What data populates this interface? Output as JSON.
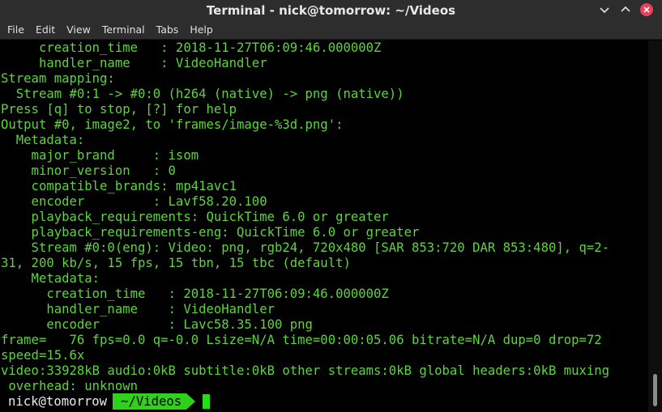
{
  "window": {
    "title": "Terminal - nick@tomorrow: ~/Videos"
  },
  "menu": [
    "File",
    "Edit",
    "View",
    "Terminal",
    "Tabs",
    "Help"
  ],
  "colors": {
    "terminal_text": "#5cd43c",
    "background": "#000000",
    "titlebar": "#2d2d2d",
    "prompt_dir_bg": "#2fd11c",
    "close_button": "#e93f57"
  },
  "terminal": {
    "lines": [
      "     creation_time   : 2018-11-27T06:09:46.000000Z",
      "     handler_name    : VideoHandler",
      "Stream mapping:",
      "  Stream #0:1 -> #0:0 (h264 (native) -> png (native))",
      "Press [q] to stop, [?] for help",
      "Output #0, image2, to 'frames/image-%3d.png':",
      "  Metadata:",
      "    major_brand     : isom",
      "    minor_version   : 0",
      "    compatible_brands: mp41avc1",
      "    encoder         : Lavf58.20.100",
      "    playback_requirements: QuickTime 6.0 or greater",
      "    playback_requirements-eng: QuickTime 6.0 or greater",
      "    Stream #0:0(eng): Video: png, rgb24, 720x480 [SAR 853:720 DAR 853:480], q=2-",
      "31, 200 kb/s, 15 fps, 15 tbn, 15 tbc (default)",
      "    Metadata:",
      "      creation_time   : 2018-11-27T06:09:46.000000Z",
      "      handler_name    : VideoHandler",
      "      encoder         : Lavc58.35.100 png",
      "frame=   76 fps=0.0 q=-0.0 Lsize=N/A time=00:00:05.06 bitrate=N/A dup=0 drop=72",
      "speed=15.6x",
      "video:33928kB audio:0kB subtitle:0kB other streams:0kB global headers:0kB muxing",
      " overhead: unknown"
    ]
  },
  "prompt": {
    "user": "nick@tomorrow",
    "dir": "~/Videos"
  }
}
